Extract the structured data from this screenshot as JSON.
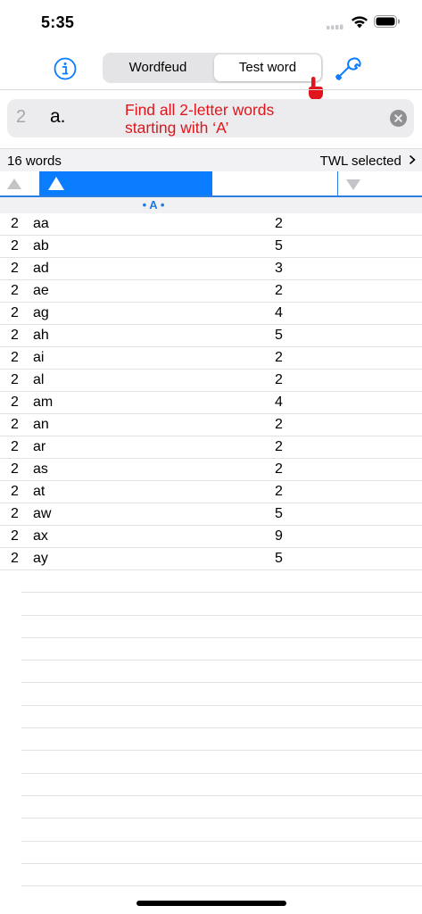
{
  "status": {
    "time": "5:35"
  },
  "toolbar": {
    "segments": [
      "Wordfeud",
      "Test word"
    ],
    "selected_segment": "Test word"
  },
  "search": {
    "count": "2",
    "value": "a.",
    "hint": "Find all 2-letter words\nstarting with ‘A’"
  },
  "results": {
    "word_count": "16 words",
    "dictionary": "TWL selected",
    "section": "• A •",
    "rows": [
      {
        "len": "2",
        "word": "aa",
        "score": "2"
      },
      {
        "len": "2",
        "word": "ab",
        "score": "5"
      },
      {
        "len": "2",
        "word": "ad",
        "score": "3"
      },
      {
        "len": "2",
        "word": "ae",
        "score": "2"
      },
      {
        "len": "2",
        "word": "ag",
        "score": "4"
      },
      {
        "len": "2",
        "word": "ah",
        "score": "5"
      },
      {
        "len": "2",
        "word": "ai",
        "score": "2"
      },
      {
        "len": "2",
        "word": "al",
        "score": "2"
      },
      {
        "len": "2",
        "word": "am",
        "score": "4"
      },
      {
        "len": "2",
        "word": "an",
        "score": "2"
      },
      {
        "len": "2",
        "word": "ar",
        "score": "2"
      },
      {
        "len": "2",
        "word": "as",
        "score": "2"
      },
      {
        "len": "2",
        "word": "at",
        "score": "2"
      },
      {
        "len": "2",
        "word": "aw",
        "score": "5"
      },
      {
        "len": "2",
        "word": "ax",
        "score": "9"
      },
      {
        "len": "2",
        "word": "ay",
        "score": "5"
      }
    ]
  },
  "icons": {
    "info": "info-circle-icon",
    "settings": "wrench-icon",
    "pointer": "hand-pointer-icon",
    "clear": "clear-circle-icon",
    "chevron": "chevron-right-icon"
  },
  "colors": {
    "accent": "#0a7cff",
    "hint": "#e0161c",
    "segment_bg": "#e4e4e7"
  }
}
